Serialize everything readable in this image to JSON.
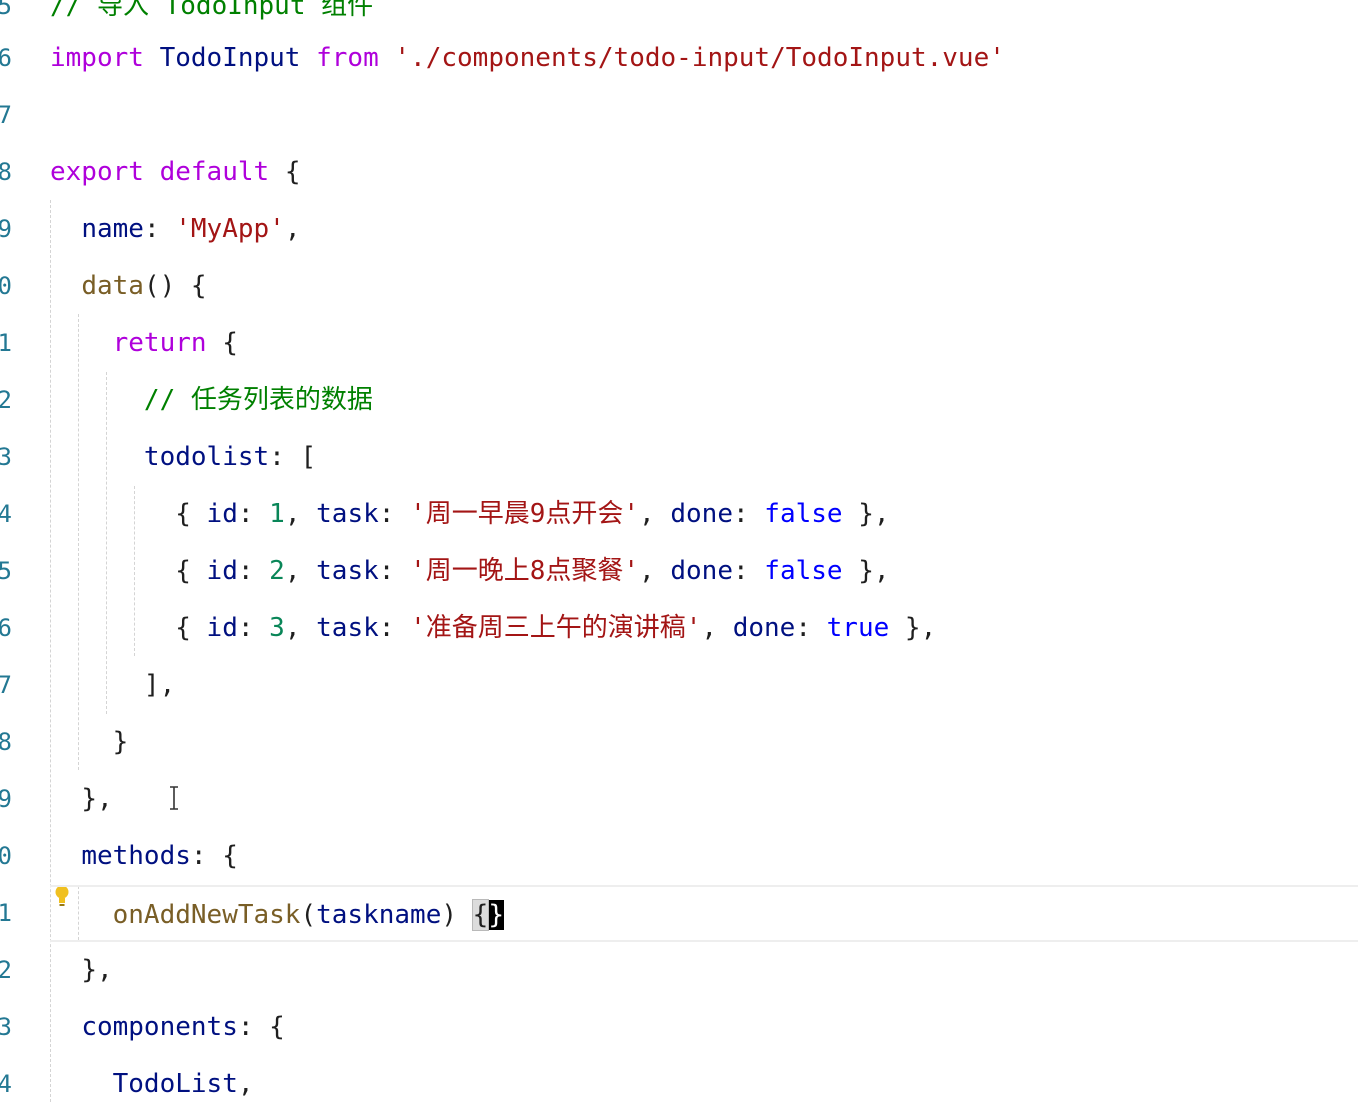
{
  "editor": {
    "line_numbers": [
      "5",
      "6",
      "7",
      "8",
      "9",
      "0",
      "1",
      "2",
      "3",
      "4",
      "5",
      "6",
      "7",
      "8",
      "9",
      "0",
      "1",
      "2",
      "3",
      "4"
    ],
    "lines": {
      "l05": {
        "comment": "// 导入 TodoInput 组件"
      },
      "l06": {
        "kw_import": "import",
        "ident": "TodoInput",
        "kw_from": "from",
        "path": "'./components/todo-input/TodoInput.vue'"
      },
      "l08": {
        "kw_export": "export",
        "kw_default": "default",
        "brace": "{"
      },
      "l09": {
        "key": "name",
        "colon": ":",
        "value": "'MyApp'",
        "comma": ","
      },
      "l10": {
        "fn": "data",
        "parens": "()",
        "brace": "{"
      },
      "l11": {
        "kw_return": "return",
        "brace": "{"
      },
      "l12": {
        "comment": "// 任务列表的数据"
      },
      "l13": {
        "key": "todolist",
        "colon": ":",
        "bracket": "["
      },
      "l14": {
        "open": "{",
        "id_key": "id",
        "id_val": "1",
        "task_key": "task",
        "task_val": "'周一早晨9点开会'",
        "done_key": "done",
        "done_val": "false",
        "close": "},"
      },
      "l15": {
        "open": "{",
        "id_key": "id",
        "id_val": "2",
        "task_key": "task",
        "task_val": "'周一晚上8点聚餐'",
        "done_key": "done",
        "done_val": "false",
        "close": "},"
      },
      "l16": {
        "open": "{",
        "id_key": "id",
        "id_val": "3",
        "task_key": "task",
        "task_val": "'准备周三上午的演讲稿'",
        "done_key": "done",
        "done_val": "true",
        "close": "},"
      },
      "l17": {
        "text": "],"
      },
      "l18": {
        "text": "}"
      },
      "l19": {
        "text": "},"
      },
      "l20": {
        "key": "methods",
        "colon": ":",
        "brace": "{"
      },
      "l21": {
        "fn": "onAddNewTask",
        "open_paren": "(",
        "param": "taskname",
        "close_paren": ")",
        "brace_open": "{",
        "brace_close": "}"
      },
      "l22": {
        "text": "},"
      },
      "l23": {
        "key": "components",
        "colon": ":",
        "brace": "{"
      },
      "l24": {
        "ident": "TodoList",
        "comma": ","
      }
    },
    "icons": {
      "lightbulb": "lightbulb-icon",
      "text_cursor": "text-cursor-icon"
    },
    "colors": {
      "keyword": "#af00db",
      "boolean": "#0000ff",
      "string": "#a31515",
      "number": "#098658",
      "comment": "#008000",
      "property": "#001080",
      "function": "#795e26",
      "line_number": "#237893",
      "lightbulb": "#f0c020"
    }
  }
}
